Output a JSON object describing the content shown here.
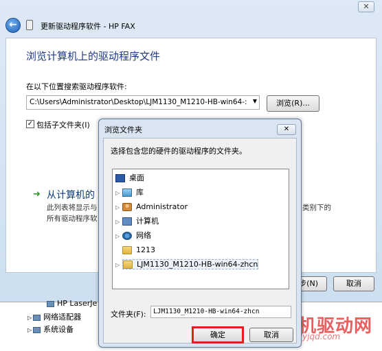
{
  "wizard": {
    "title": "更新驱动程序软件 - HP FAX",
    "close_glyph": "✕",
    "back_glyph": "←",
    "heading": "浏览计算机上的驱动程序文件",
    "search_label": "在以下位置搜索驱动程序软件:",
    "path_value": "C:\\Users\\Administrator\\Desktop\\LJM1130_M1210-HB-win64-:",
    "browse_label": "浏览(R)...",
    "include_subfolders_label": "包括子文件夹(I)",
    "include_subfolders_checked": true,
    "pick_title": "从计算机的",
    "pick_desc_line1": "此列表将显示与",
    "pick_desc_line2": "所有驱动程序软",
    "pick_desc_right": "类别下的",
    "next_label": "步(N)",
    "cancel_label": "取消"
  },
  "device_manager": {
    "items": [
      {
        "label": "HP LaserJe"
      },
      {
        "label": "网络适配器"
      },
      {
        "label": "系统设备"
      }
    ]
  },
  "watermark": {
    "text": "打印机驱动网",
    "url": "www.dyjqd.com",
    "color": "#e02a2a"
  },
  "browse_dialog": {
    "title": "浏览文件夹",
    "prompt": "选择包含您的硬件的驱动程序的文件夹。",
    "tree": [
      {
        "label": "桌面",
        "icon": "desktop-icon",
        "expander": ""
      },
      {
        "label": "库",
        "icon": "library-icon",
        "expander": "▷"
      },
      {
        "label": "Administrator",
        "icon": "user-folder-icon",
        "expander": "▷"
      },
      {
        "label": "计算机",
        "icon": "computer-icon",
        "expander": "▷"
      },
      {
        "label": "网络",
        "icon": "network-icon",
        "expander": "▷"
      },
      {
        "label": "1213",
        "icon": "folder-icon",
        "expander": ""
      },
      {
        "label": "LJM1130_M1210-HB-win64-zhcn",
        "icon": "folder-icon",
        "expander": "▷",
        "selected": true
      }
    ],
    "folder_label": "文件夹(F):",
    "folder_value": "LJM1130_M1210-HB-win64-zhcn",
    "ok_label": "确定",
    "cancel_label": "取消",
    "highlight_color": "#e01f1f"
  }
}
